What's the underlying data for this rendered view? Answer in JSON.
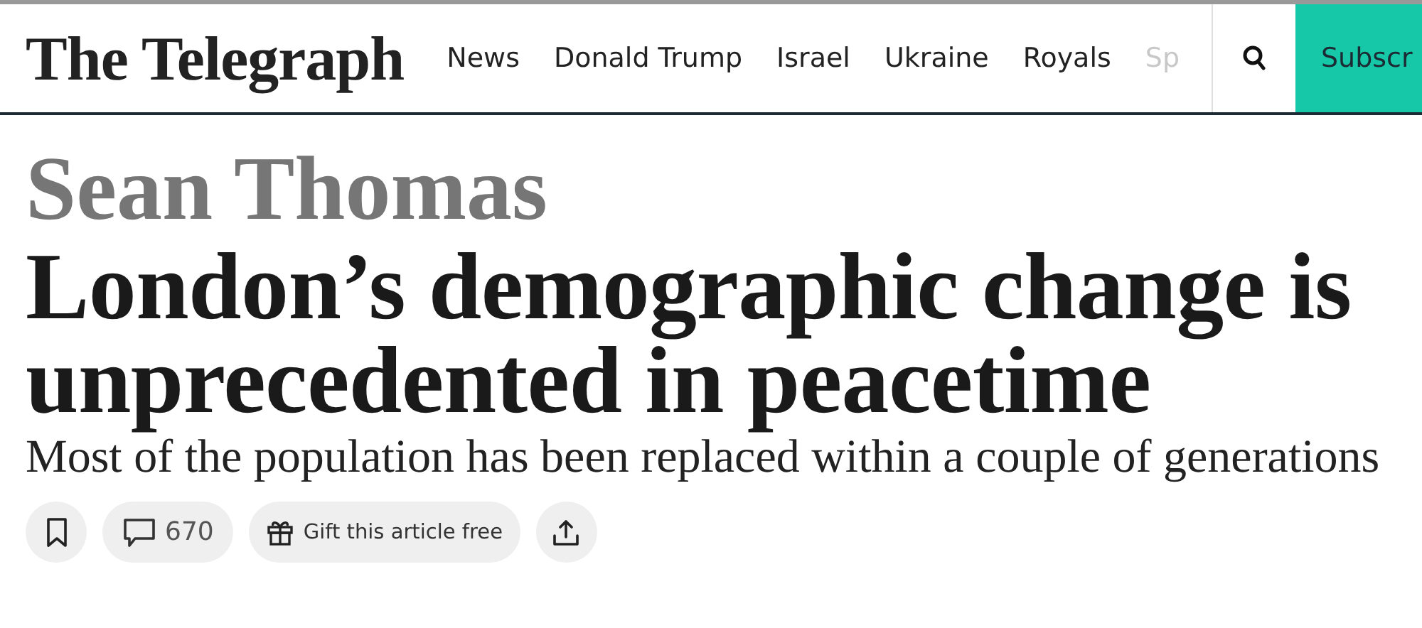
{
  "header": {
    "logo": "The Telegraph",
    "nav": [
      {
        "label": "News",
        "faded": false
      },
      {
        "label": "Donald Trump",
        "faded": false
      },
      {
        "label": "Israel",
        "faded": false
      },
      {
        "label": "Ukraine",
        "faded": false
      },
      {
        "label": "Royals",
        "faded": false
      },
      {
        "label": "Sp",
        "faded": true
      }
    ],
    "subscribe": "Subscr"
  },
  "article": {
    "author": "Sean Thomas",
    "headline": "London’s demographic change is unprecedented in peacetime",
    "standfirst": "Most of the population has been replaced within a couple of generations",
    "actions": [
      {
        "kind": "bookmark"
      },
      {
        "kind": "comments",
        "label": "670"
      },
      {
        "kind": "gift",
        "label": "Gift this article free"
      },
      {
        "kind": "share"
      }
    ]
  }
}
